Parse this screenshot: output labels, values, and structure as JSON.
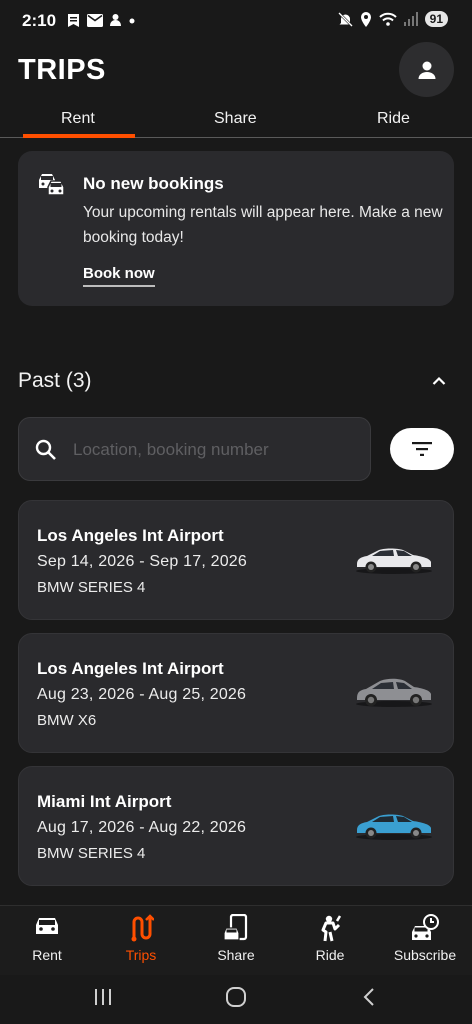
{
  "status_bar": {
    "time": "2:10",
    "battery": "91",
    "icons": [
      "news-icon",
      "mail-icon",
      "bell-icon",
      "dot-icon",
      "mute-icon",
      "location-icon",
      "wifi-icon",
      "signal-icon",
      "battery-icon"
    ]
  },
  "header": {
    "title": "TRIPS",
    "profile_icon": "person-icon"
  },
  "tabs": [
    {
      "label": "Rent",
      "active": true
    },
    {
      "label": "Share",
      "active": false
    },
    {
      "label": "Ride",
      "active": false
    }
  ],
  "notice": {
    "icon": "cars-icon",
    "title": "No new bookings",
    "text": "Your upcoming rentals will appear here. Make a new booking today!",
    "action": "Book now"
  },
  "past": {
    "title": "Past (3)",
    "search_placeholder": "Location, booking number",
    "trips": [
      {
        "location": "Los Angeles Int Airport",
        "dates": "Sep 14, 2026 - Sep 17, 2026",
        "model": "BMW SERIES 4",
        "car_color": "#e9e9ec"
      },
      {
        "location": "Los Angeles Int Airport",
        "dates": "Aug 23, 2026 - Aug 25, 2026",
        "model": "BMW X6",
        "car_color": "#8e8f93"
      },
      {
        "location": "Miami Int Airport",
        "dates": "Aug 17, 2026 - Aug 22, 2026",
        "model": "BMW SERIES 4",
        "car_color": "#3a9fd1"
      }
    ]
  },
  "bottom_nav": [
    {
      "label": "Rent",
      "icon": "car-icon",
      "active": false
    },
    {
      "label": "Trips",
      "icon": "route-icon",
      "active": true
    },
    {
      "label": "Share",
      "icon": "share-car-icon",
      "active": false
    },
    {
      "label": "Ride",
      "icon": "ride-icon",
      "active": false
    },
    {
      "label": "Subscribe",
      "icon": "subscribe-icon",
      "active": false
    }
  ],
  "colors": {
    "accent": "#ff4f00",
    "background": "#191919",
    "card": "#2a2a2d"
  }
}
